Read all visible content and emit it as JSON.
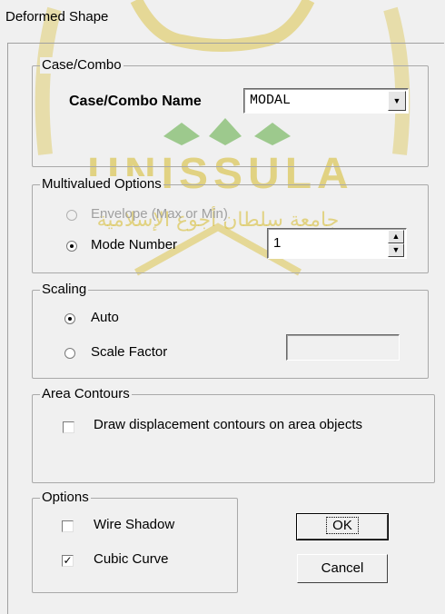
{
  "window": {
    "title": "Deformed Shape"
  },
  "watermark": {
    "text": "UNISSULA",
    "arabic": "جامعة سلطان أجوع الإسلامية"
  },
  "case_combo": {
    "legend": "Case/Combo",
    "name_label": "Case/Combo Name",
    "selected": "MODAL"
  },
  "multivalued": {
    "legend": "Multivalued Options",
    "envelope_label": "Envelope (Max or Min)",
    "mode_label": "Mode Number",
    "mode_value": "1"
  },
  "scaling": {
    "legend": "Scaling",
    "auto_label": "Auto",
    "scale_factor_label": "Scale Factor",
    "scale_factor_value": ""
  },
  "area_contours": {
    "legend": "Area Contours",
    "draw_label": "Draw displacement contours on area objects"
  },
  "options": {
    "legend": "Options",
    "wire_shadow_label": "Wire Shadow",
    "cubic_curve_label": "Cubic Curve",
    "wire_shadow_checked": false,
    "cubic_curve_checked": true
  },
  "buttons": {
    "ok": "OK",
    "cancel": "Cancel"
  }
}
